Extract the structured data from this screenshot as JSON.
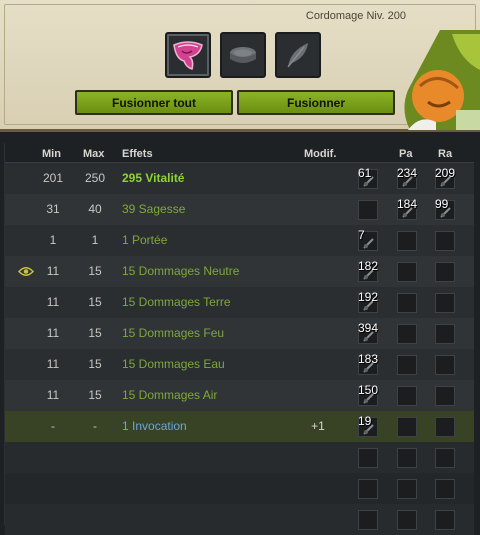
{
  "header": {
    "level_label": "Cordomage Niv. 200",
    "slots": [
      "fused-item-icon",
      "rune-stone-icon",
      "feather-icon"
    ],
    "buttons": {
      "fuse_all": "Fusionner tout",
      "fuse": "Fusionner"
    }
  },
  "table": {
    "columns": {
      "min": "Min",
      "max": "Max",
      "effects": "Effets",
      "modif": "Modif.",
      "pa": "Pa",
      "ra": "Ra"
    },
    "rows": [
      {
        "min": "201",
        "max": "250",
        "effect": "295 Vitalité",
        "style": "bold",
        "modif": "",
        "runes": [
          "61",
          "234",
          "209"
        ]
      },
      {
        "min": "31",
        "max": "40",
        "effect": "39 Sagesse",
        "style": "sage",
        "modif": "",
        "runes": [
          "",
          "184",
          "99"
        ]
      },
      {
        "min": "1",
        "max": "1",
        "effect": "1 Portée",
        "style": "normal",
        "modif": "",
        "runes": [
          "7",
          "",
          ""
        ]
      },
      {
        "min": "11",
        "max": "15",
        "effect": "15 Dommages Neutre",
        "style": "normal",
        "modif": "",
        "runes": [
          "182",
          "",
          ""
        ],
        "eye": true
      },
      {
        "min": "11",
        "max": "15",
        "effect": "15 Dommages Terre",
        "style": "normal",
        "modif": "",
        "runes": [
          "192",
          "",
          ""
        ]
      },
      {
        "min": "11",
        "max": "15",
        "effect": "15 Dommages Feu",
        "style": "normal",
        "modif": "",
        "runes": [
          "394",
          "",
          ""
        ]
      },
      {
        "min": "11",
        "max": "15",
        "effect": "15 Dommages Eau",
        "style": "normal",
        "modif": "",
        "runes": [
          "183",
          "",
          ""
        ]
      },
      {
        "min": "11",
        "max": "15",
        "effect": "15 Dommages Air",
        "style": "normal",
        "modif": "",
        "runes": [
          "150",
          "",
          ""
        ]
      },
      {
        "min": "-",
        "max": "-",
        "effect": "1 Invocation",
        "style": "inv",
        "modif": "+1",
        "runes": [
          "19",
          "",
          ""
        ],
        "highlight": true
      }
    ],
    "blank_rows": 3
  },
  "colors": {
    "accent_green": "#8ed236",
    "effect_green": "#7fa83c",
    "invocation_blue": "#6fa4d6",
    "button_green": "#7aa21c"
  }
}
